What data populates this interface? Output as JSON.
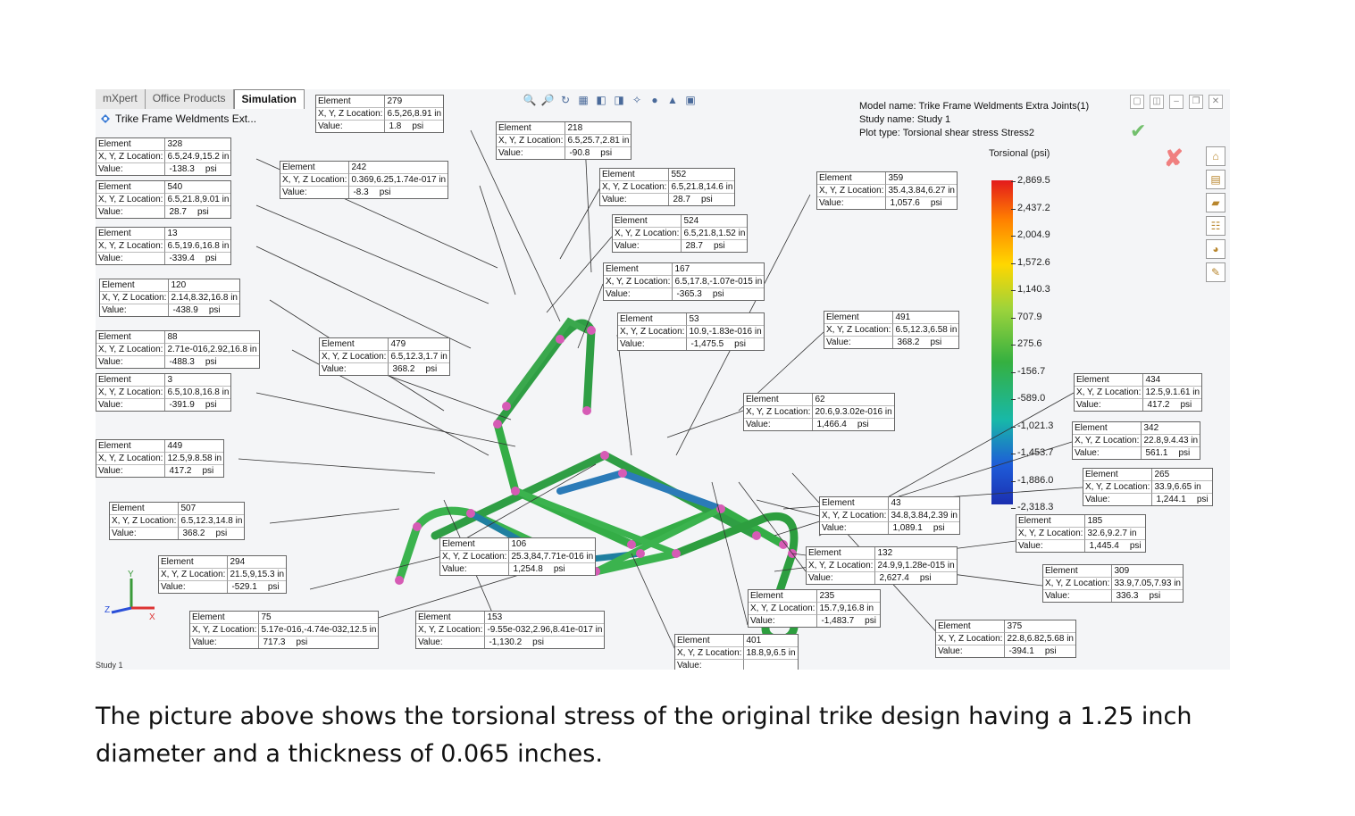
{
  "tabs": [
    {
      "label": "mXpert"
    },
    {
      "label": "Office Products"
    },
    {
      "label": "Simulation"
    }
  ],
  "tree_title": "Trike Frame Weldments Ext...",
  "info": {
    "model": "Model name: Trike Frame Weldments Extra Joints(1)",
    "study": "Study name: Study 1",
    "plot": "Plot type: Torsional shear stress Stress2"
  },
  "legend": {
    "title": "Torsional (psi)",
    "ticks": [
      "2,869.5",
      "2,437.2",
      "2,004.9",
      "1,572.6",
      "1,140.3",
      "707.9",
      "275.6",
      "-156.7",
      "-589.0",
      "-1,021.3",
      "-1,453.7",
      "-1,886.0",
      "-2,318.3"
    ]
  },
  "probe_labels": {
    "element": "Element",
    "location": "X, Y, Z Location:",
    "value": "Value:"
  },
  "probes": [
    {
      "element": "279",
      "location": "6.5,26,8.91 in",
      "value": "1.8",
      "unit": "psi"
    },
    {
      "element": "218",
      "location": "6.5,25.7,2.81 in",
      "value": "-90.8",
      "unit": "psi"
    },
    {
      "element": "328",
      "location": "6.5,24.9,15.2 in",
      "value": "-138.3",
      "unit": "psi"
    },
    {
      "element": "540",
      "location": "6.5,21.8,9.01 in",
      "value": "28.7",
      "unit": "psi"
    },
    {
      "element": "242",
      "location": "0.369,6.25,1.74e-017 in",
      "value": "-8.3",
      "unit": "psi"
    },
    {
      "element": "552",
      "location": "6.5,21.8,14.6 in",
      "value": "28.7",
      "unit": "psi"
    },
    {
      "element": "359",
      "location": "35.4,3.84,6.27 in",
      "value": "1,057.6",
      "unit": "psi"
    },
    {
      "element": "524",
      "location": "6.5,21.8,1.52 in",
      "value": "28.7",
      "unit": "psi"
    },
    {
      "element": "13",
      "location": "6.5,19.6,16.8 in",
      "value": "-339.4",
      "unit": "psi"
    },
    {
      "element": "167",
      "location": "6.5,17.8,-1.07e-015 in",
      "value": "-365.3",
      "unit": "psi"
    },
    {
      "element": "120",
      "location": "2.14,8.32,16.8 in",
      "value": "-438.9",
      "unit": "psi"
    },
    {
      "element": "53",
      "location": "10.9,-1.83e-016 in",
      "value": "-1,475.5",
      "unit": "psi"
    },
    {
      "element": "491",
      "location": "6.5,12.3,6.58 in",
      "value": "368.2",
      "unit": "psi"
    },
    {
      "element": "88",
      "location": "2.71e-016,2.92,16.8 in",
      "value": "-488.3",
      "unit": "psi"
    },
    {
      "element": "479",
      "location": "6.5,12.3,1.7 in",
      "value": "368.2",
      "unit": "psi"
    },
    {
      "element": "3",
      "location": "6.5,10.8,16.8 in",
      "value": "-391.9",
      "unit": "psi"
    },
    {
      "element": "434",
      "location": "12.5,9.1.61 in",
      "value": "417.2",
      "unit": "psi"
    },
    {
      "element": "62",
      "location": "20.6,9.3.02e-016 in",
      "value": "1,466.4",
      "unit": "psi"
    },
    {
      "element": "342",
      "location": "22.8,9.4.43 in",
      "value": "561.1",
      "unit": "psi"
    },
    {
      "element": "449",
      "location": "12.5,9.8.58 in",
      "value": "417.2",
      "unit": "psi"
    },
    {
      "element": "265",
      "location": "33.9,6.65 in",
      "value": "1,244.1",
      "unit": "psi"
    },
    {
      "element": "43",
      "location": "34.8,3.84,2.39 in",
      "value": "1,089.1",
      "unit": "psi"
    },
    {
      "element": "507",
      "location": "6.5,12.3,14.8 in",
      "value": "368.2",
      "unit": "psi"
    },
    {
      "element": "185",
      "location": "32.6,9.2.7 in",
      "value": "1,445.4",
      "unit": "psi"
    },
    {
      "element": "106",
      "location": "25.3,84,7.71e-016 in",
      "value": "1,254.8",
      "unit": "psi"
    },
    {
      "element": "132",
      "location": "24.9,9,1.28e-015 in",
      "value": "2,627.4",
      "unit": "psi"
    },
    {
      "element": "294",
      "location": "21.5,9,15.3 in",
      "value": "-529.1",
      "unit": "psi"
    },
    {
      "element": "309",
      "location": "33.9,7.05,7.93 in",
      "value": "336.3",
      "unit": "psi"
    },
    {
      "element": "235",
      "location": "15.7,9,16.8 in",
      "value": "-1,483.7",
      "unit": "psi"
    },
    {
      "element": "75",
      "location": "5.17e-016,-4.74e-032,12.5 in",
      "value": "717.3",
      "unit": "psi"
    },
    {
      "element": "153",
      "location": "-9.55e-032,2.96,8.41e-017 in",
      "value": "-1,130.2",
      "unit": "psi"
    },
    {
      "element": "375",
      "location": "22.8,6.82,5.68 in",
      "value": "-394.1",
      "unit": "psi"
    },
    {
      "element": "401",
      "location": "18.8,9,6.5 in",
      "value": "",
      "unit": ""
    }
  ],
  "status": "Study 1",
  "caption": "The picture above shows the torsional stress of the original trike design having a 1.25 inch diameter and a thickness of 0.065 inches."
}
